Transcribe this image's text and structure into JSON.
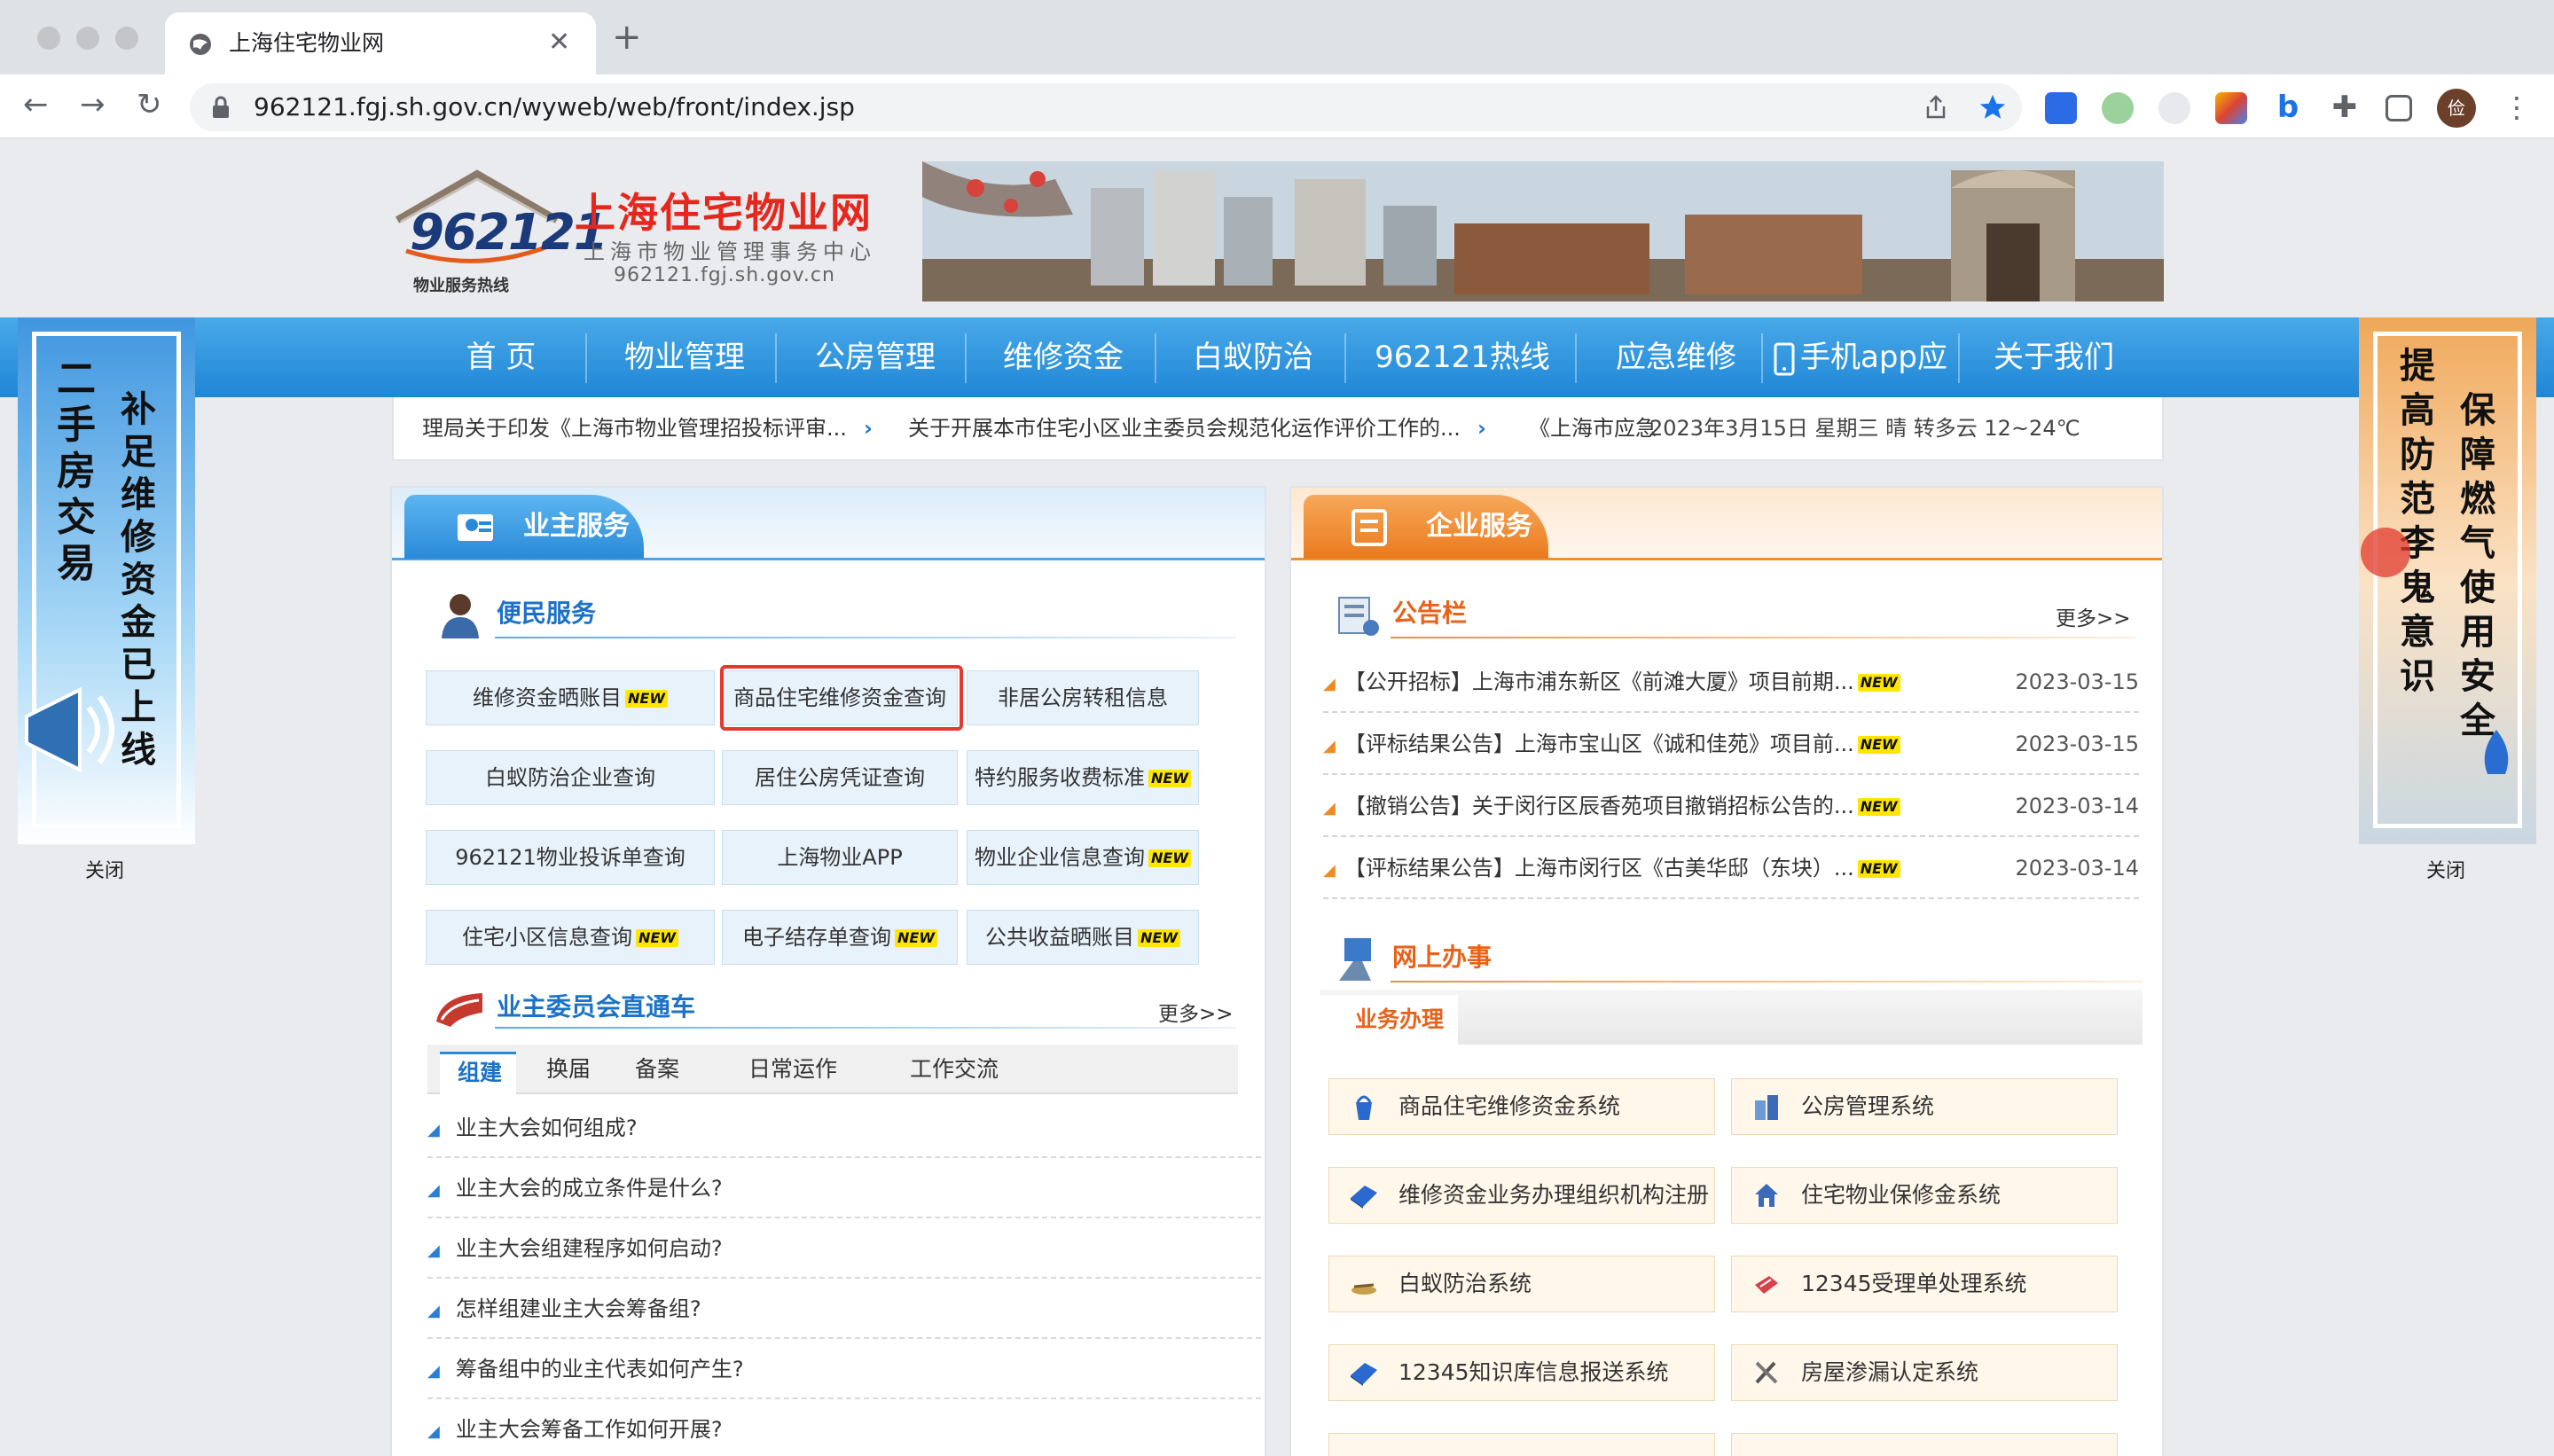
{
  "browser": {
    "tab_title": "上海住宅物业网",
    "url": "962121.fgj.sh.gov.cn/wyweb/web/front/index.jsp",
    "profile_initial": "俭"
  },
  "site": {
    "logo_number": "962121",
    "logo_hotline": "物业服务热线",
    "logo_title": "上海住宅物业网",
    "logo_subtitle": "上海市物业管理事务中心",
    "logo_domain": "962121.fgj.sh.gov.cn"
  },
  "nav": [
    {
      "label": "首 页"
    },
    {
      "label": "物业管理"
    },
    {
      "label": "公房管理"
    },
    {
      "label": "维修资金"
    },
    {
      "label": "白蚁防治"
    },
    {
      "label": "962121热线"
    },
    {
      "label": "应急维修"
    },
    {
      "label": "手机app应用"
    },
    {
      "label": "关于我们"
    }
  ],
  "ticker": {
    "item1": "理局关于印发《上海市物业管理招投标评审...",
    "item2": "关于开展本市住宅小区业主委员会规范化运作评价工作的...",
    "item3": "《上海市应急",
    "weather": "2023年3月15日 星期三  晴 转多云  12~24℃",
    "arrow": "›"
  },
  "left_ad": {
    "col1": "二手房交易",
    "col2": "补足维修资金已上线",
    "close": "关闭"
  },
  "right_ad": {
    "col1": "提高防范李鬼意识",
    "col2": "保障燃气使用安全",
    "close": "关闭"
  },
  "owner_service": {
    "title": "业主服务",
    "convenience": "便民服务",
    "new_badge": "NEW",
    "buttons": [
      {
        "label": "维修资金晒账目",
        "new": true
      },
      {
        "label": "商品住宅维修资金查询",
        "new": false
      },
      {
        "label": "非居公房转租信息",
        "new": false
      },
      {
        "label": "白蚁防治企业查询",
        "new": false
      },
      {
        "label": "居住公房凭证查询",
        "new": false
      },
      {
        "label": "特约服务收费标准",
        "new": true
      },
      {
        "label": "962121物业投诉单查询",
        "new": false
      },
      {
        "label": "上海物业APP",
        "new": false
      },
      {
        "label": "物业企业信息查询",
        "new": true
      },
      {
        "label": "住宅小区信息查询",
        "new": true
      },
      {
        "label": "电子结存单查询",
        "new": true
      },
      {
        "label": "公共收益晒账目",
        "new": true
      }
    ],
    "committee": "业主委员会直通车",
    "more": "更多>>",
    "tabs": [
      "组建",
      "换届",
      "备案",
      "日常运作",
      "工作交流"
    ],
    "faqs": [
      "业主大会如何组成?",
      "业主大会的成立条件是什么?",
      "业主大会组建程序如何启动?",
      "怎样组建业主大会筹备组?",
      "筹备组中的业主代表如何产生?",
      "业主大会筹备工作如何开展?"
    ]
  },
  "enterprise_service": {
    "title": "企业服务",
    "bulletin": "公告栏",
    "more": "更多>>",
    "notices": [
      {
        "text": "【公开招标】上海市浦东新区《前滩大厦》项目前期...",
        "date": "2023-03-15"
      },
      {
        "text": "【评标结果公告】上海市宝山区《诚和佳苑》项目前...",
        "date": "2023-03-15"
      },
      {
        "text": "【撤销公告】关于闵行区辰香苑项目撤销招标公告的...",
        "date": "2023-03-14"
      },
      {
        "text": "【评标结果公告】上海市闵行区《古美华邸（东块）...",
        "date": "2023-03-14"
      }
    ],
    "online": "网上办事",
    "business_tab": "业务办理",
    "systems": [
      {
        "label": "商品住宅维修资金系统",
        "icon": "bucket-icon"
      },
      {
        "label": "公房管理系统",
        "icon": "buildings-icon"
      },
      {
        "label": "维修资金业务办理组织机构注册",
        "icon": "book-icon"
      },
      {
        "label": "住宅物业保修金系统",
        "icon": "house-icon"
      },
      {
        "label": "白蚁防治系统",
        "icon": "termite-icon"
      },
      {
        "label": "12345受理单处理系统",
        "icon": "phone-icon"
      },
      {
        "label": "12345知识库信息报送系统",
        "icon": "book-icon"
      },
      {
        "label": "房屋渗漏认定系统",
        "icon": "tools-icon"
      }
    ]
  }
}
